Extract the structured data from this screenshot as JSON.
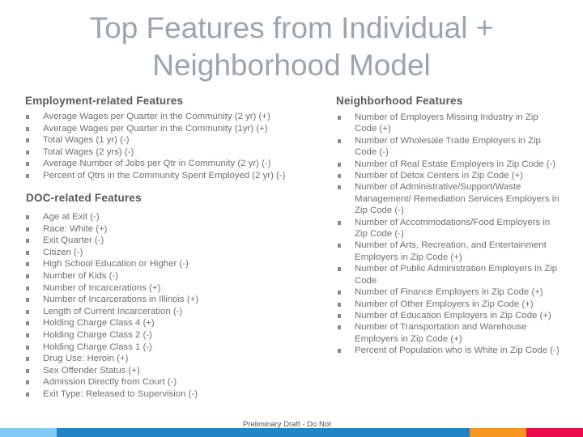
{
  "title": "Top Features from Individual + Neighborhood Model",
  "employment": {
    "heading": "Employment-related Features",
    "items": [
      "Average Wages per Quarter in the Community (2 yr) (+)",
      "Average Wages per Quarter in the Community (1yr) (+)",
      "Total Wages (1 yr) (-)",
      "Total Wages (2 yrs) (-)",
      "Average Number of Jobs per Qtr in Community (2 yr) (-)",
      "Percent of Qtrs in the Community Spent Employed (2 yr) (-)"
    ]
  },
  "doc": {
    "heading": "DOC-related Features",
    "items": [
      "Age at Exit (-)",
      "Race: White (+)",
      "Exit Quarter (-)",
      "Citizen (-)",
      "High School Education or Higher (-)",
      "Number of Kids (-)",
      "Number of Incarcerations (+)",
      "Number of Incarcerations in Illinois (+)",
      "Length of Current Incarceration (-)",
      "Holding Charge Class 4 (+)",
      "Holding Charge Class 2 (-)",
      "Holding Charge Class 1 (-)",
      "Drug Use: Heroin (+)",
      "Sex Offender Status (+)",
      "Admission Directly from Court (-)",
      "Exit Type: Released to Supervision (-)"
    ]
  },
  "neighborhood": {
    "heading": "Neighborhood Features",
    "items": [
      "Number of Employers Missing Industry in Zip Code (+)",
      "Number of Wholesale Trade Employers in Zip Code (-)",
      "Number of Real Estate Employers in Zip Code (-)",
      "Number of Detox Centers in Zip Code (+)",
      "Number of Administrative/Support/Waste Management/ Remediation Services Employers in Zip Code (-)",
      "Number of Accommodations/Food Employers in Zip Code (-)",
      "Number of Arts, Recreation, and Entertainment Employers in Zip Code (+)",
      "Number of Public Administration Employers in Zip Code",
      "Number of Finance Employers in Zip Code (+)",
      "Number of Other Employers in Zip Code (+)",
      "Number of Education Employers in Zip Code (+)",
      "Number of Transportation and Warehouse Employers in Zip Code (+)",
      "Percent of Population who is White in Zip Code (-)"
    ]
  },
  "footer": {
    "text": "Preliminary Draft - Do Not"
  },
  "colors": {
    "bar_light_blue": "#7fcbf5",
    "bar_blue": "#2383c6",
    "bar_orange": "#f7961e",
    "bar_pink": "#ec0b4f"
  }
}
